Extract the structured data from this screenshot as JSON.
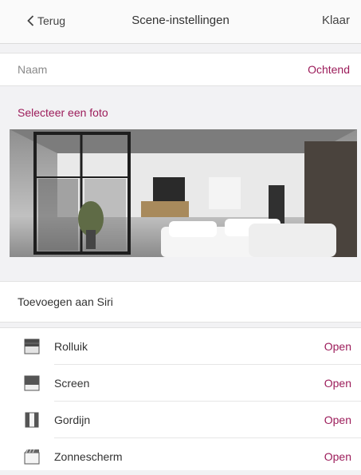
{
  "nav": {
    "back_label": "Terug",
    "title": "Scene-instellingen",
    "done_label": "Klaar"
  },
  "name_row": {
    "label": "Naam",
    "value": "Ochtend"
  },
  "photo": {
    "select_label": "Selecteer een foto"
  },
  "siri": {
    "label": "Toevoegen aan Siri"
  },
  "devices": [
    {
      "name": "Rolluik",
      "status": "Open",
      "icon": "roller-shutter-icon"
    },
    {
      "name": "Screen",
      "status": "Open",
      "icon": "screen-blind-icon"
    },
    {
      "name": "Gordijn",
      "status": "Open",
      "icon": "curtain-icon"
    },
    {
      "name": "Zonnescherm",
      "status": "Open",
      "icon": "awning-icon"
    }
  ],
  "colors": {
    "accent": "#9c1c5a",
    "background": "#f2f2f4"
  }
}
